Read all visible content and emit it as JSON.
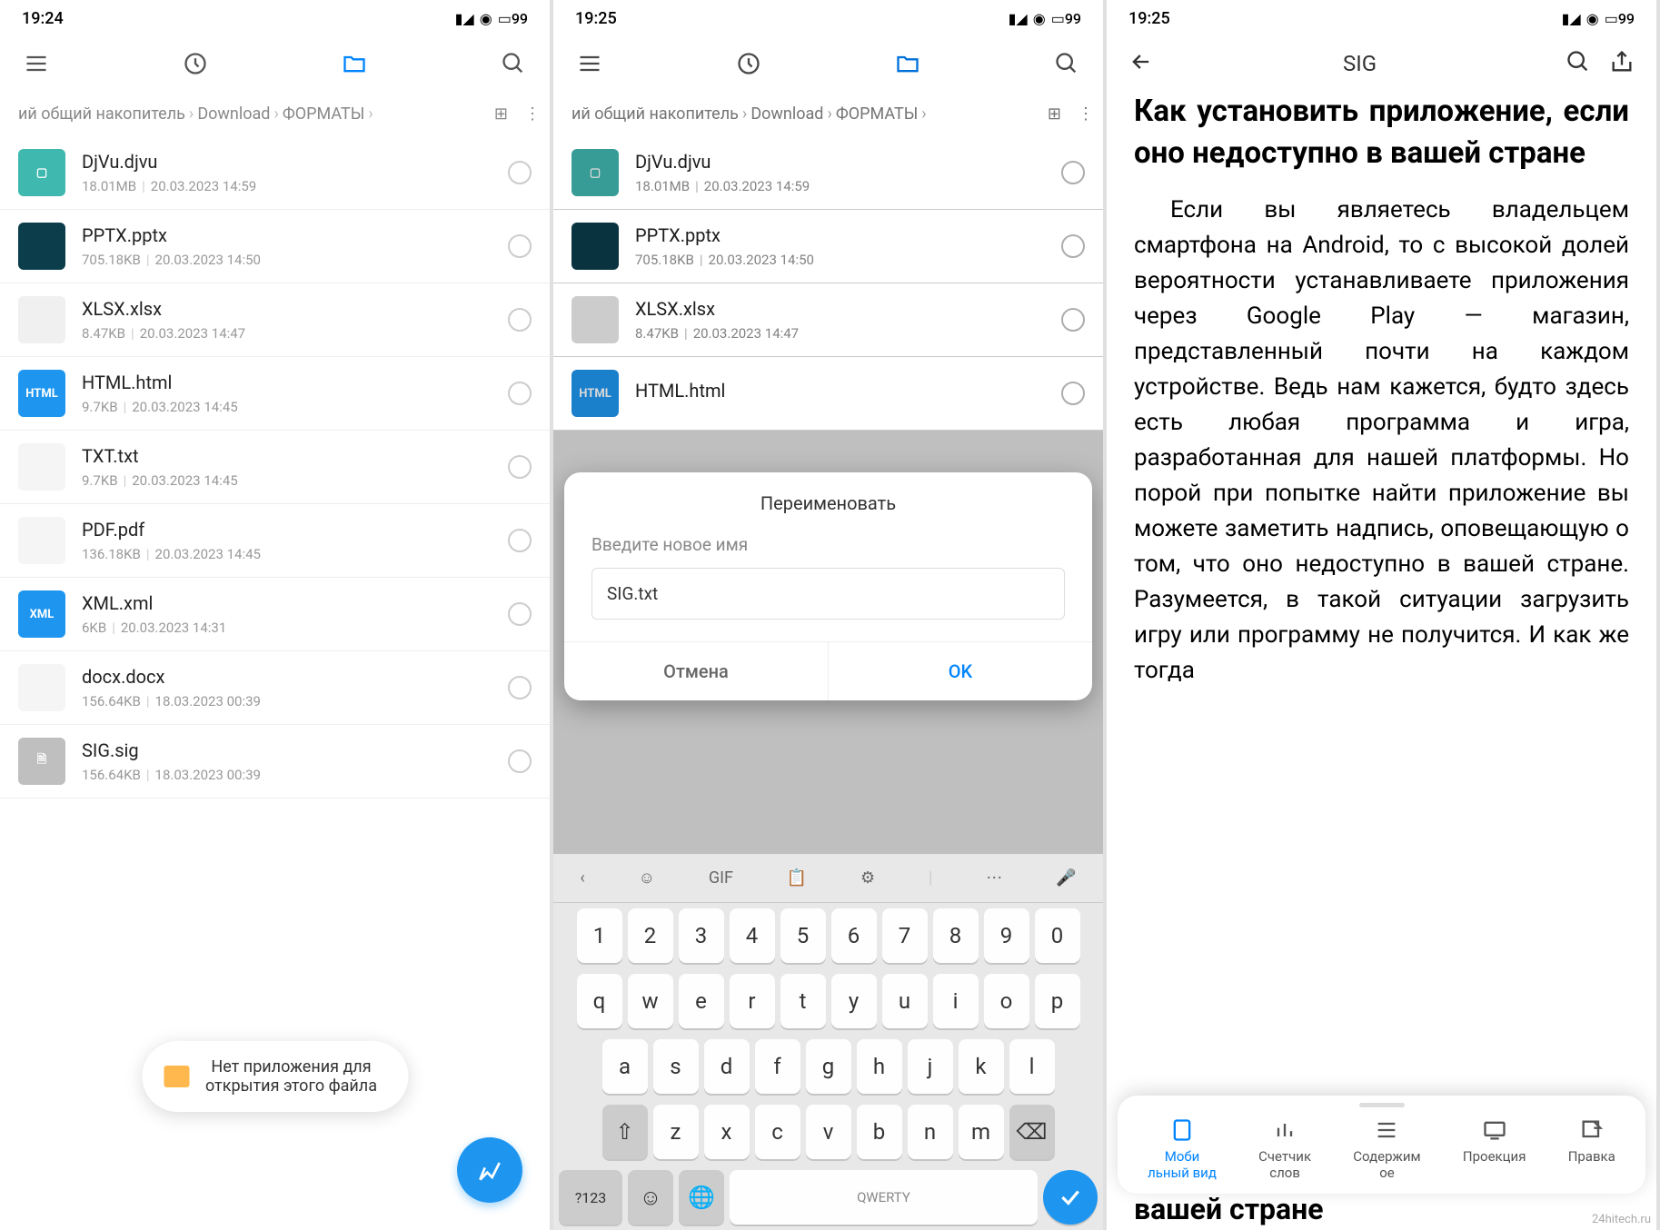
{
  "screen1": {
    "time": "19:24",
    "battery": "99",
    "breadcrumb": [
      "ий общий накопитель",
      "Download",
      "ФОРМАТЫ"
    ],
    "files": [
      {
        "name": "DjVu.djvu",
        "size": "18.01MB",
        "date": "20.03.2023 14:59",
        "bg": "#3fb8af",
        "label": "▢"
      },
      {
        "name": "PPTX.pptx",
        "size": "705.18KB",
        "date": "20.03.2023 14:50",
        "bg": "#0b3d4a",
        "label": ""
      },
      {
        "name": "XLSX.xlsx",
        "size": "8.47KB",
        "date": "20.03.2023 14:47",
        "bg": "#f0f0f0",
        "label": ""
      },
      {
        "name": "HTML.html",
        "size": "9.7KB",
        "date": "20.03.2023 14:45",
        "bg": "#1e96f0",
        "label": "HTML"
      },
      {
        "name": "TXT.txt",
        "size": "9.7KB",
        "date": "20.03.2023 14:45",
        "bg": "#f5f5f5",
        "label": ""
      },
      {
        "name": "PDF.pdf",
        "size": "136.18KB",
        "date": "20.03.2023 14:45",
        "bg": "#f5f5f5",
        "label": ""
      },
      {
        "name": "XML.xml",
        "size": "6KB",
        "date": "20.03.2023 14:31",
        "bg": "#1e96f0",
        "label": "XML"
      },
      {
        "name": "docx.docx",
        "size": "156.64KB",
        "date": "18.03.2023 00:39",
        "bg": "#f5f5f5",
        "label": ""
      },
      {
        "name": "SIG.sig",
        "size": "156.64KB",
        "date": "18.03.2023 00:39",
        "bg": "#bfbfbf",
        "label": "🗎"
      }
    ],
    "toast": "Нет приложения для\nоткрытия этого файла"
  },
  "screen2": {
    "time": "19:25",
    "battery": "99",
    "breadcrumb": [
      "ий общий накопитель",
      "Download",
      "ФОРМАТЫ"
    ],
    "files": [
      {
        "name": "DjVu.djvu",
        "size": "18.01MB",
        "date": "20.03.2023 14:59",
        "bg": "#3fb8af",
        "label": "▢"
      },
      {
        "name": "PPTX.pptx",
        "size": "705.18KB",
        "date": "20.03.2023 14:50",
        "bg": "#0b3d4a",
        "label": ""
      },
      {
        "name": "XLSX.xlsx",
        "size": "8.47KB",
        "date": "20.03.2023 14:47",
        "bg": "#f0f0f0",
        "label": ""
      },
      {
        "name": "HTML.html",
        "size": "",
        "date": "",
        "bg": "#1e96f0",
        "label": "HTML"
      }
    ],
    "dialog": {
      "title": "Переименовать",
      "hint": "Введите новое имя",
      "value": "SIG.txt",
      "cancel": "Отмена",
      "ok": "OK"
    },
    "keyboard": {
      "gif": "GIF",
      "row1": [
        "1",
        "2",
        "3",
        "4",
        "5",
        "6",
        "7",
        "8",
        "9",
        "0"
      ],
      "row2": [
        "q",
        "w",
        "e",
        "r",
        "t",
        "y",
        "u",
        "i",
        "o",
        "p"
      ],
      "row3": [
        "a",
        "s",
        "d",
        "f",
        "g",
        "h",
        "j",
        "k",
        "l"
      ],
      "row4": [
        "z",
        "x",
        "c",
        "v",
        "b",
        "n",
        "m"
      ],
      "symkey": "?123",
      "space": "QWERTY"
    }
  },
  "screen3": {
    "time": "19:25",
    "battery": "99",
    "title": "SIG",
    "article_title": "Как установить приложение, если оно недоступно в вашей стране",
    "article_body": "Если вы являетесь владельцем смартфона на Android, то с высокой долей вероятности устанавливаете приложения через Google Play — магазин, представленный почти на каждом устройстве. Ведь нам кажется, будто здесь есть любая программа и игра, разработанная для нашей платформы. Но порой при попытке найти приложение вы можете заметить надпись, оповещающую о том, что оно недоступно в вашей стране. Разумеется, в такой ситуации загрузить игру или программу не получится. И как же тогда",
    "article_trail": "вашей стране",
    "bottom": [
      {
        "label": "Моби\nльный вид",
        "active": true
      },
      {
        "label": "Счетчик\nслов"
      },
      {
        "label": "Содержим\nое"
      },
      {
        "label": "Проекция"
      },
      {
        "label": "Правка"
      }
    ]
  },
  "watermark": "24hitech.ru"
}
